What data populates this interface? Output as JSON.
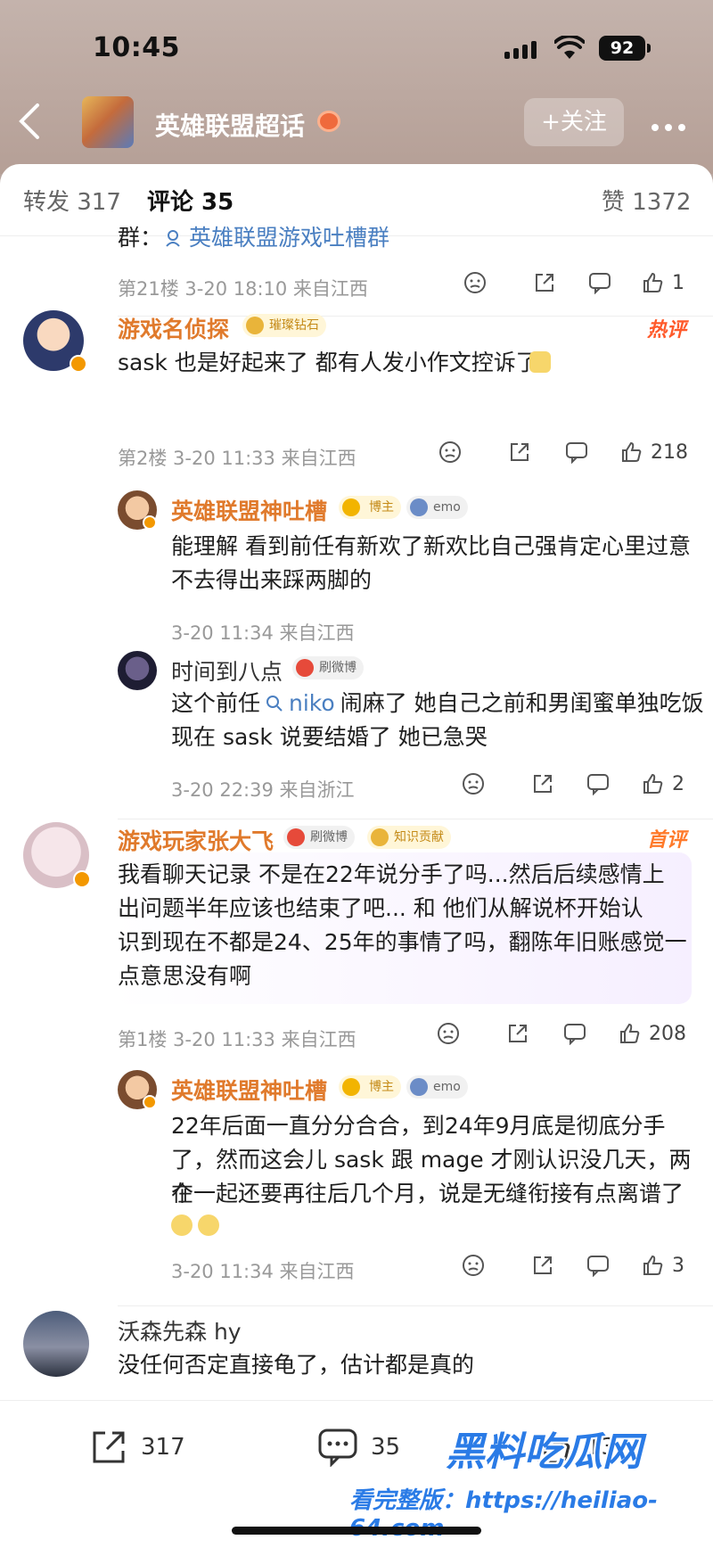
{
  "status": {
    "time": "10:45",
    "battery": "92"
  },
  "header": {
    "back_icon": "chevron-left-icon",
    "topic_title": "英雄联盟超话",
    "follow_label": "+关注",
    "more_icon": "ellipsis-icon"
  },
  "tabs": [
    {
      "label": "转发 317"
    },
    {
      "label": "评论 35"
    },
    {
      "label": "赞 1372"
    }
  ],
  "colors": {
    "accent": "#ff8200",
    "name": "#e07a2c",
    "meta": "#999999"
  },
  "comments": {
    "c21": {
      "group_prefix": "群：",
      "group_name": "英雄联盟游戏吐槽群",
      "meta": "第21楼 3-20 18:10 来自江西",
      "likes": "1"
    },
    "c2": {
      "name": "游戏名侦探",
      "badge": "璀璨钻石",
      "hot": "热评",
      "text": "sask 也是好起来了 都有人发小作文控诉了",
      "meta": "第2楼 3-20 11:33 来自江西",
      "likes": "218",
      "replies": [
        {
          "name": "英雄联盟神吐槽",
          "role": "博主",
          "mood": "emo",
          "text_line1": "能理解 看到前任有新欢了新欢比自己强肯定心里过意",
          "text_line2": "不去得出来踩两脚的",
          "meta": "3-20 11:34 来自江西"
        },
        {
          "name": "时间到八点",
          "tag": "刷微博",
          "text_prefix": "这个前任",
          "text_mention": "niko",
          "text_rest": "闹麻了 她自己之前和男闺蜜单独吃饭",
          "text_line2": "现在 sask 说要结婚了 她已急哭",
          "meta": "3-20 22:39 来自浙江",
          "likes": "2"
        }
      ]
    },
    "c1": {
      "name": "游戏玩家张大飞",
      "tag": "刷微博",
      "badge": "知识贡献",
      "hot": "首评",
      "text_line1": "我看聊天记录 不是在22年说分手了吗...然后后续感情上",
      "text_line2": "出问题半年应该也结束了吧... 和 他们从解说杯开始认",
      "text_line3": "识到现在不都是24、25年的事情了吗，翻陈年旧账感觉一",
      "text_line4": "点意思没有啊",
      "meta": "第1楼 3-20 11:33 来自江西",
      "likes": "208",
      "reply": {
        "name": "英雄联盟神吐槽",
        "role": "博主",
        "mood": "emo",
        "text_line1": "22年后面一直分分合合，到24年9月底是彻底分手",
        "text_line2": "了，然而这会儿 sask 跟 mage 才刚认识没几天，两个",
        "text_line3": "在一起还要再往后几个月，说是无缝衔接有点离谱了",
        "meta": "3-20 11:34 来自江西",
        "likes": "3"
      }
    },
    "c0": {
      "name": "沃森先森 hy",
      "text": "没任何否定直接龟了，估计都是真的"
    }
  },
  "bottom_bar": {
    "repost_count": "317",
    "comment_count": "35",
    "like_count": "1372"
  },
  "watermark": {
    "brand": "黑料吃瓜网",
    "line": "看完整版：https://heiliao-64.com"
  }
}
